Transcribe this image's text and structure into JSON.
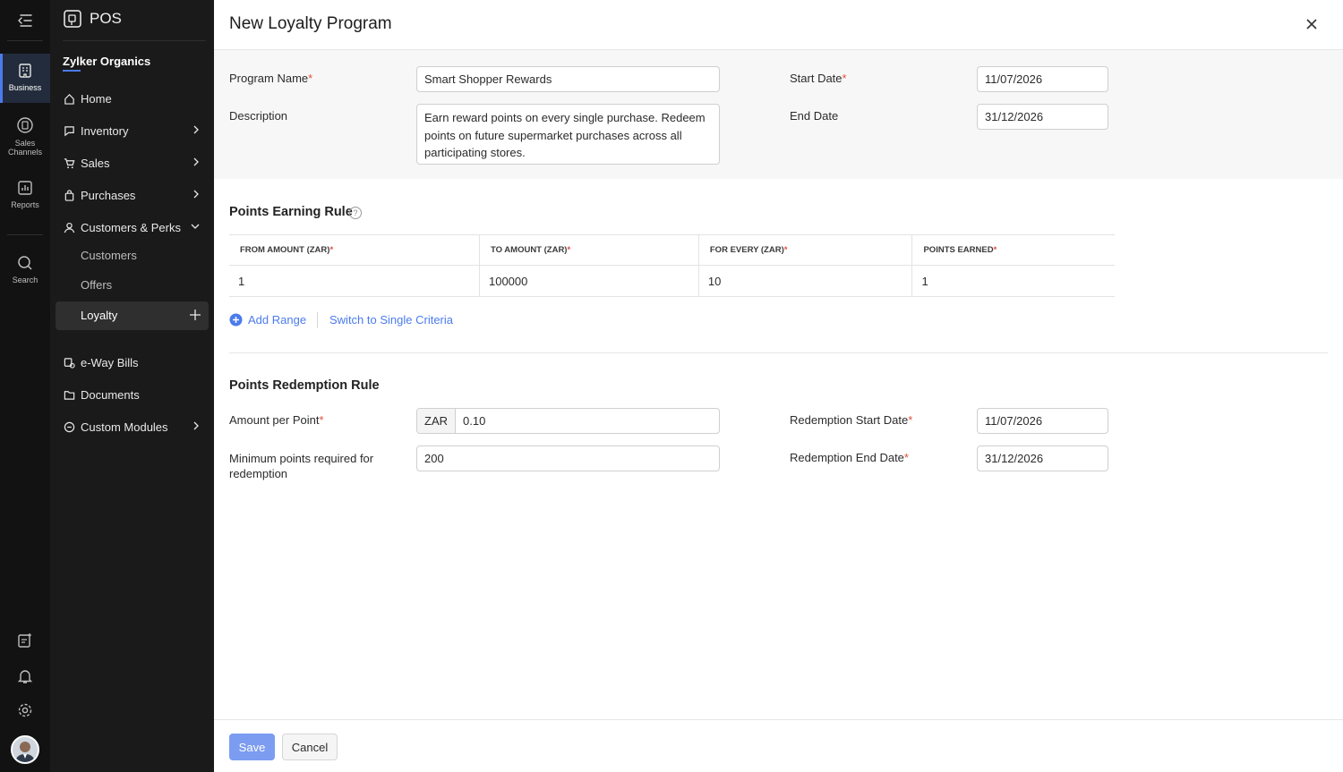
{
  "rail": {
    "items": [
      {
        "label": "Business",
        "icon": "business-icon"
      },
      {
        "label": "Sales Channels",
        "icon": "sales-channels-icon"
      },
      {
        "label": "Reports",
        "icon": "reports-icon"
      },
      {
        "label": "Search",
        "icon": "search-icon"
      }
    ],
    "bottom_icons": [
      "add-note-icon",
      "bell-icon",
      "gear-icon"
    ]
  },
  "nav": {
    "app_name": "POS",
    "org_name": "Zylker Organics",
    "items": [
      {
        "label": "Home",
        "icon": "home-icon"
      },
      {
        "label": "Inventory",
        "icon": "inventory-icon"
      },
      {
        "label": "Sales",
        "icon": "cart-icon"
      },
      {
        "label": "Purchases",
        "icon": "bag-icon"
      },
      {
        "label": "Customers & Perks",
        "icon": "person-icon"
      },
      {
        "label": "e-Way Bills",
        "icon": "truck-icon"
      },
      {
        "label": "Documents",
        "icon": "folder-icon"
      },
      {
        "label": "Custom Modules",
        "icon": "modules-icon"
      }
    ],
    "sub_items": [
      "Customers",
      "Offers",
      "Loyalty"
    ]
  },
  "form": {
    "title": "New Loyalty Program",
    "program_name_label": "Program Name",
    "program_name_value": "Smart Shopper Rewards",
    "description_label": "Description",
    "description_value": "Earn reward points on every single purchase. Redeem points on future supermarket purchases across all participating stores.",
    "start_date_label": "Start Date",
    "start_date_value": "11/07/2026",
    "end_date_label": "End Date",
    "end_date_value": "31/12/2026",
    "required_mark": "*"
  },
  "earning": {
    "title": "Points Earning Rule",
    "help": "?",
    "columns": [
      "FROM AMOUNT (ZAR)",
      "TO AMOUNT (ZAR)",
      "FOR EVERY (ZAR)",
      "POINTS EARNED"
    ],
    "rows": [
      [
        "1",
        "100000",
        "10",
        "1"
      ]
    ],
    "add_range": "Add Range",
    "switch_link": "Switch to Single Criteria"
  },
  "redemption": {
    "title": "Points Redemption Rule",
    "amount_label": "Amount per Point",
    "currency": "ZAR",
    "amount_value": "0.10",
    "min_points_label": "Minimum points required for redemption",
    "min_points_value": "200",
    "start_label": "Redemption Start Date",
    "start_value": "11/07/2026",
    "end_label": "Redemption End Date",
    "end_value": "31/12/2026"
  },
  "footer": {
    "save": "Save",
    "cancel": "Cancel"
  },
  "colors": {
    "accent": "#4b7bec",
    "save_button": "#7b9cf0",
    "required": "#e0503d"
  }
}
